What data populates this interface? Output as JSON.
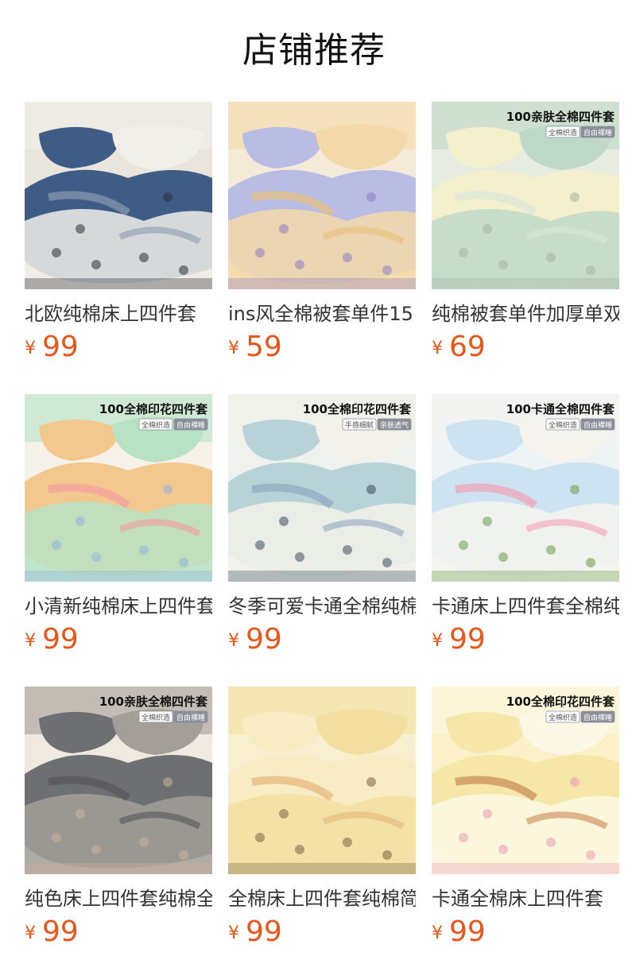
{
  "header": {
    "title": "店铺推荐"
  },
  "currency_symbol": "¥",
  "products": [
    {
      "name": "北欧纯棉床上四件套",
      "price": "99",
      "badge_title": "",
      "badge_tags": [],
      "colors": {
        "bg": "#e9e4dc",
        "a": "#3f5c86",
        "b": "#f1efe9",
        "c": "#8c9bb0",
        "d": "#2c2f36"
      }
    },
    {
      "name": "ins风全棉被套单件15",
      "price": "59",
      "badge_title": "",
      "badge_tags": [],
      "colors": {
        "bg": "#f4ead7",
        "a": "#b9bde3",
        "b": "#f3d9a9",
        "c": "#e9c07a",
        "d": "#8e7ec2"
      }
    },
    {
      "name": "纯棉被套单件加厚单双",
      "price": "69",
      "badge_title": "100亲肤全棉四件套",
      "badge_tags": [
        "全棉织造",
        "自由裸睡"
      ],
      "colors": {
        "bg": "#e6ecdf",
        "a": "#f4efcc",
        "b": "#bfd9c8",
        "c": "#d9e7d8",
        "d": "#a6b3a2"
      }
    },
    {
      "name": "小清新纯棉床上四件套",
      "price": "99",
      "badge_title": "100全棉印花四件套",
      "badge_tags": [
        "全棉织造",
        "自由裸睡"
      ],
      "colors": {
        "bg": "#f6f2ea",
        "a": "#f3c88e",
        "b": "#b7e3c4",
        "c": "#f29c9c",
        "d": "#8fb1e3"
      }
    },
    {
      "name": "冬季可爱卡通全棉纯棉",
      "price": "99",
      "badge_title": "100全棉印花四件套",
      "badge_tags": [
        "手感细腻",
        "亲肤透气"
      ],
      "colors": {
        "bg": "#eef1ee",
        "a": "#b8d3d8",
        "b": "#f3f1ea",
        "c": "#8ea7c2",
        "d": "#3c4c5e"
      }
    },
    {
      "name": "卡通床上四件套全棉纯",
      "price": "99",
      "badge_title": "100卡通全棉四件套",
      "badge_tags": [
        "全棉织造",
        "自由裸睡"
      ],
      "colors": {
        "bg": "#eef3f6",
        "a": "#cde3f1",
        "b": "#f6f4ef",
        "c": "#f3a0b5",
        "d": "#6d9a4a"
      }
    },
    {
      "name": "纯色床上四件套纯棉全",
      "price": "99",
      "badge_title": "100亲肤全棉四件套",
      "badge_tags": [
        "全棉织造",
        "自由裸睡"
      ],
      "colors": {
        "bg": "#efe9e0",
        "a": "#6e6f72",
        "b": "#a39f98",
        "c": "#55565a",
        "d": "#c8b49a"
      }
    },
    {
      "name": "全棉床上四件套纯棉简约",
      "price": "99",
      "badge_title": "",
      "badge_tags": [],
      "colors": {
        "bg": "#f7efcf",
        "a": "#f8ecc4",
        "b": "#f2dfa0",
        "c": "#e7b57a",
        "d": "#7c6242"
      }
    },
    {
      "name": "卡通全棉床上四件套",
      "price": "99",
      "badge_title": "100全棉印花四件套",
      "badge_tags": [
        "全棉织造",
        "自由裸睡"
      ],
      "colors": {
        "bg": "#fbf0c8",
        "a": "#f6e7a8",
        "b": "#fdf8e6",
        "c": "#c98a55",
        "d": "#e79ab0"
      }
    }
  ]
}
